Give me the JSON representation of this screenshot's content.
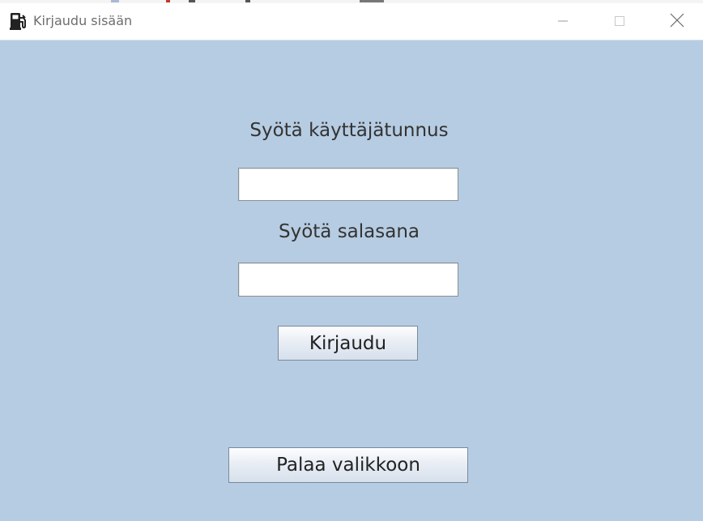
{
  "window": {
    "title": "Kirjaudu sisään",
    "app_icon": "fuel-pump-icon",
    "controls": {
      "minimize_icon": "minimize-icon",
      "maximize_icon": "maximize-icon",
      "close_icon": "close-icon"
    }
  },
  "form": {
    "username_label": "Syötä käyttäjätunnus",
    "username_value": "",
    "password_label": "Syötä salasana",
    "password_value": "",
    "login_button": "Kirjaudu",
    "back_button": "Palaa valikkoon"
  },
  "colors": {
    "background": "#b6cce2",
    "titlebar": "#ffffff",
    "text": "#333333"
  }
}
